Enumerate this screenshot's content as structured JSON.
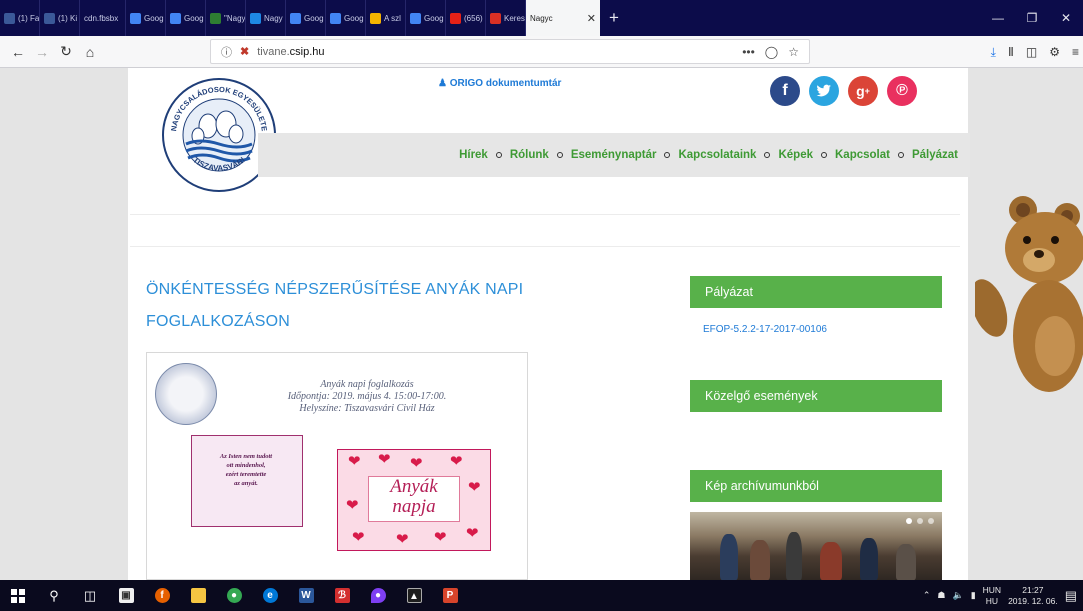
{
  "browser": {
    "tabs": [
      {
        "label": "(1) Fa",
        "favicon": "facebook-icon",
        "color": "#3b5998"
      },
      {
        "label": "(1) Ki",
        "favicon": "facebook-icon",
        "color": "#3b5998"
      },
      {
        "label": "cdn.fbsbx",
        "favicon": "none",
        "color": "#0c0c4a"
      },
      {
        "label": "Goog",
        "favicon": "google-icon",
        "color": "#4285f4"
      },
      {
        "label": "Goog",
        "favicon": "google-icon",
        "color": "#4285f4"
      },
      {
        "label": "\"Nagy",
        "favicon": "page-icon",
        "color": "#2e7d32"
      },
      {
        "label": "Nagy",
        "favicon": "page-icon",
        "color": "#1e88e5"
      },
      {
        "label": "Goog",
        "favicon": "google-icon",
        "color": "#4285f4"
      },
      {
        "label": "Goog",
        "favicon": "google-icon",
        "color": "#4285f4"
      },
      {
        "label": "A szl",
        "favicon": "question-icon",
        "color": "#f4b400"
      },
      {
        "label": "Goog",
        "favicon": "google-icon",
        "color": "#4285f4"
      },
      {
        "label": "(656)",
        "favicon": "youtube-icon",
        "color": "#e62117"
      },
      {
        "label": "Keres",
        "favicon": "mail-icon",
        "color": "#d93025"
      }
    ],
    "active_tab": {
      "label": "Nagyc"
    },
    "new_tab": "+",
    "url": {
      "prefix": "tivane.",
      "host": "csip.hu"
    },
    "url_menu": "•••"
  },
  "page": {
    "origo_link": "ORIGO dokumentumtár",
    "logo": {
      "top_text": "NAGYCSALÁDOSOK EGYESÜLETE",
      "bottom_text": "TISZAVASVÁRI"
    },
    "social": [
      {
        "name": "facebook",
        "glyph": "f",
        "color": "#2c4a8a"
      },
      {
        "name": "twitter",
        "glyph": "t",
        "color": "#2ba5e0"
      },
      {
        "name": "google-plus",
        "glyph": "g+",
        "color": "#db4437"
      },
      {
        "name": "pinterest",
        "glyph": "p",
        "color": "#e9305f"
      }
    ],
    "menu": [
      "Hírek",
      "Rólunk",
      "Eseménynaptár",
      "Kapcsolataink",
      "Képek",
      "Kapcsolat",
      "Pályázat"
    ],
    "post": {
      "title_line1": "ÖNKÉNTESSÉG NÉPSZERŰSÍTÉSE ANYÁK NAPI",
      "title_line2": "FOGLALKOZÁSON",
      "flyer_line1": "Anyák napi foglalkozás",
      "flyer_line2": "Időpontja: 2019. május 4. 15:00-17:00.",
      "flyer_line3": "Helyszíne: Tiszavasvári Civil Ház",
      "card_poem_lines": [
        "Az Isten nem tudott",
        "ott mindenhol,",
        "ezért teremtette",
        "az anyát."
      ],
      "card_label_line1": "Anyák",
      "card_label_line2": "napja"
    },
    "sidebar": {
      "palyazat_title": "Pályázat",
      "palyazat_link": "EFOP-5.2.2-17-2017-00106",
      "events_title": "Közelgő események",
      "archive_title": "Kép archívumunkból"
    },
    "colors": {
      "accent_green": "#58b14a",
      "link_blue": "#2d8fd8",
      "menu_green": "#3e9a34"
    }
  },
  "taskbar": {
    "language": {
      "line1": "HUN",
      "line2": "HU"
    },
    "time": "21:27",
    "date": "2019. 12. 06."
  }
}
